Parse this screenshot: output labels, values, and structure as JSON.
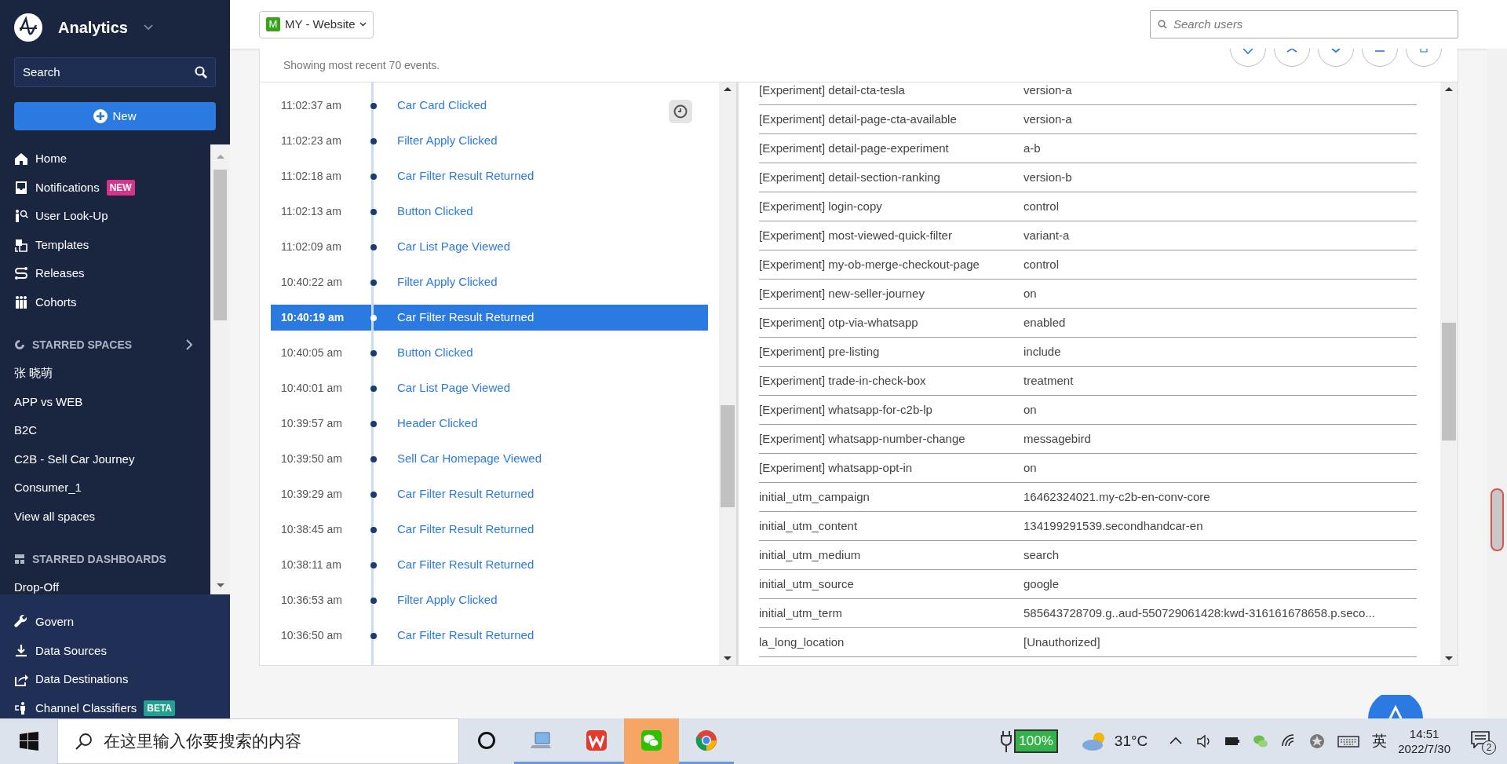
{
  "sidebar": {
    "app_title": "Analytics",
    "search": {
      "placeholder": "Search"
    },
    "new_button": "New",
    "nav": [
      {
        "label": "Home"
      },
      {
        "label": "Notifications",
        "badge": {
          "text": "NEW",
          "color": "#d6348b"
        }
      },
      {
        "label": "User Look-Up"
      },
      {
        "label": "Templates"
      },
      {
        "label": "Releases"
      },
      {
        "label": "Cohorts"
      }
    ],
    "starred_spaces": {
      "title": "STARRED SPACES",
      "items": [
        "张 晓萌",
        "APP vs WEB",
        "B2C",
        "C2B - Sell Car Journey",
        "Consumer_1"
      ],
      "view_all": "View all spaces"
    },
    "starred_dashboards": {
      "title": "STARRED DASHBOARDS",
      "items": [
        "Drop-Off"
      ]
    },
    "footer_nav": [
      {
        "label": "Govern"
      },
      {
        "label": "Data Sources"
      },
      {
        "label": "Data Destinations"
      },
      {
        "label": "Channel Classifiers",
        "badge": {
          "text": "BETA",
          "color": "#22a090"
        }
      }
    ]
  },
  "header": {
    "project": {
      "initial": "M",
      "name": "MY - Website"
    },
    "search": {
      "placeholder": "Search users"
    }
  },
  "events": {
    "summary": "Showing most recent 70 events.",
    "rows": [
      {
        "time": "11:02:37 am",
        "name": "Car Card Clicked",
        "selected": false
      },
      {
        "time": "11:02:23 am",
        "name": "Filter Apply Clicked",
        "selected": false
      },
      {
        "time": "11:02:18 am",
        "name": "Car Filter Result Returned",
        "selected": false
      },
      {
        "time": "11:02:13 am",
        "name": "Button Clicked",
        "selected": false
      },
      {
        "time": "11:02:09 am",
        "name": "Car List Page Viewed",
        "selected": false
      },
      {
        "time": "10:40:22 am",
        "name": "Filter Apply Clicked",
        "selected": false
      },
      {
        "time": "10:40:19 am",
        "name": "Car Filter Result Returned",
        "selected": true
      },
      {
        "time": "10:40:05 am",
        "name": "Button Clicked",
        "selected": false
      },
      {
        "time": "10:40:01 am",
        "name": "Car List Page Viewed",
        "selected": false
      },
      {
        "time": "10:39:57 am",
        "name": "Header Clicked",
        "selected": false
      },
      {
        "time": "10:39:50 am",
        "name": "Sell Car Homepage Viewed",
        "selected": false
      },
      {
        "time": "10:39:29 am",
        "name": "Car Filter Result Returned",
        "selected": false
      },
      {
        "time": "10:38:45 am",
        "name": "Car Filter Result Returned",
        "selected": false
      },
      {
        "time": "10:38:11 am",
        "name": "Car Filter Result Returned",
        "selected": false
      },
      {
        "time": "10:36:53 am",
        "name": "Filter Apply Clicked",
        "selected": false
      },
      {
        "time": "10:36:50 am",
        "name": "Car Filter Result Returned",
        "selected": false
      }
    ]
  },
  "properties": {
    "rows": [
      {
        "key": "[Experiment] detail-cta-tesla",
        "value": "version-a"
      },
      {
        "key": "[Experiment] detail-page-cta-available",
        "value": "version-a"
      },
      {
        "key": "[Experiment] detail-page-experiment",
        "value": "a-b"
      },
      {
        "key": "[Experiment] detail-section-ranking",
        "value": "version-b"
      },
      {
        "key": "[Experiment] login-copy",
        "value": "control"
      },
      {
        "key": "[Experiment] most-viewed-quick-filter",
        "value": "variant-a"
      },
      {
        "key": "[Experiment] my-ob-merge-checkout-page",
        "value": "control"
      },
      {
        "key": "[Experiment] new-seller-journey",
        "value": "on"
      },
      {
        "key": "[Experiment] otp-via-whatsapp",
        "value": "enabled"
      },
      {
        "key": "[Experiment] pre-listing",
        "value": "include"
      },
      {
        "key": "[Experiment] trade-in-check-box",
        "value": "treatment"
      },
      {
        "key": "[Experiment] whatsapp-for-c2b-lp",
        "value": "on"
      },
      {
        "key": "[Experiment] whatsapp-number-change",
        "value": "messagebird"
      },
      {
        "key": "[Experiment] whatsapp-opt-in",
        "value": "on"
      },
      {
        "key": "initial_utm_campaign",
        "value": "16462324021.my-c2b-en-conv-core"
      },
      {
        "key": "initial_utm_content",
        "value": "134199291539.secondhandcar-en"
      },
      {
        "key": "initial_utm_medium",
        "value": "search"
      },
      {
        "key": "initial_utm_source",
        "value": "google"
      },
      {
        "key": "initial_utm_term",
        "value": "585643728709.g..aud-550729061428:kwd-316161678658.p.seco..."
      },
      {
        "key": "la_long_location",
        "value": "[Unauthorized]"
      }
    ]
  },
  "taskbar": {
    "search_placeholder": "在这里输入你要搜索的内容",
    "apps": [
      {
        "running": true,
        "flashing": false
      },
      {
        "running": true,
        "flashing": false
      },
      {
        "running": false,
        "flashing": true
      },
      {
        "running": true,
        "flashing": false
      }
    ],
    "battery": "100%",
    "temperature": "31°C",
    "ime": "英",
    "time": "14:51",
    "date": "2022/7/30",
    "notifications": "2"
  }
}
